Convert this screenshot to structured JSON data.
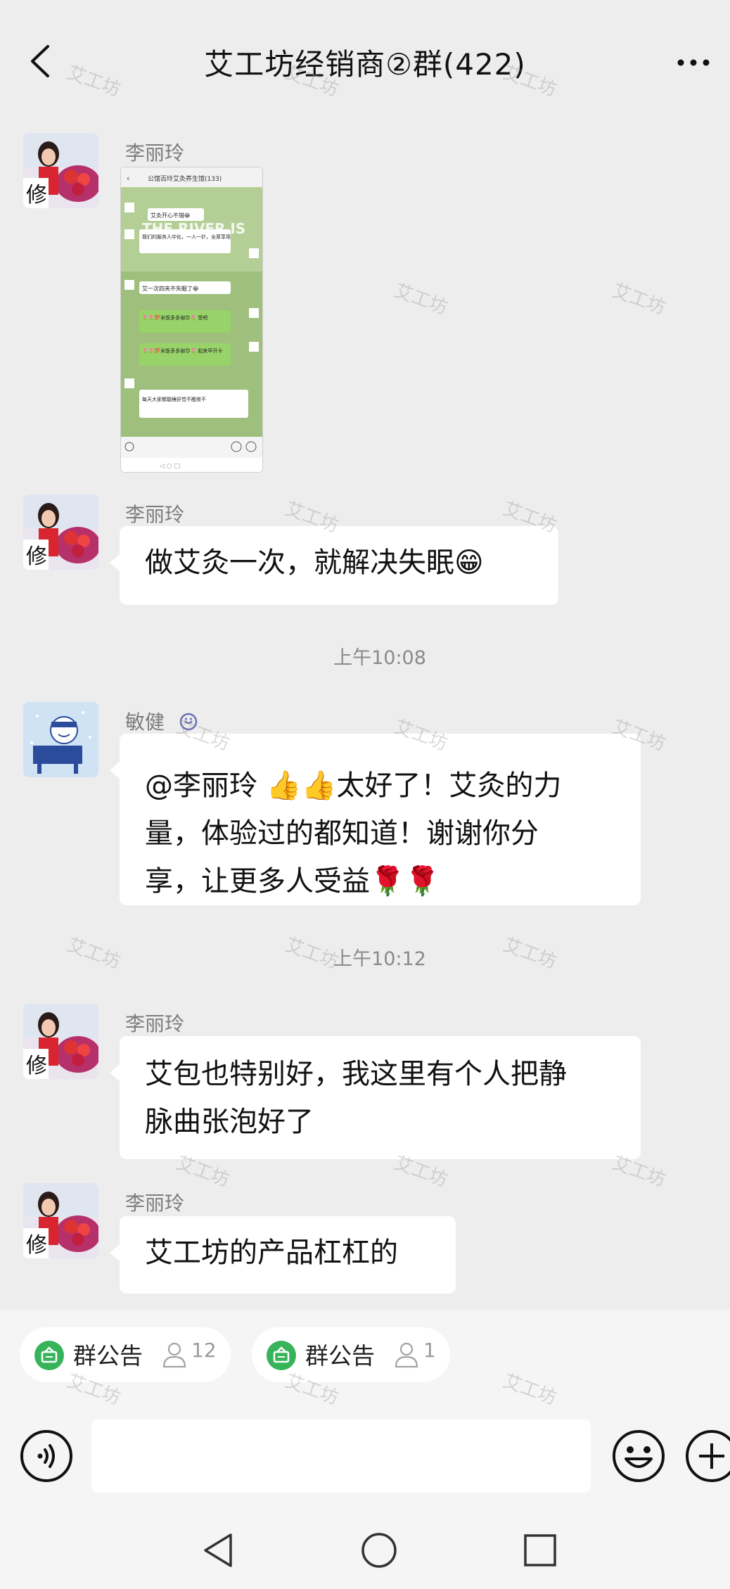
{
  "header": {
    "title": "艾工坊经销商②群(422)"
  },
  "messages": [
    {
      "sender": "李丽玲",
      "type": "image"
    },
    {
      "sender": "李丽玲",
      "text": "做艾灸一次，就解决失眠😁"
    },
    {
      "sender": "敏健",
      "lines": [
        "@李丽玲 👍👍太好了！艾灸的力",
        "量，体验过的都知道！谢谢你分",
        "享，让更多人受益🌹🌹"
      ]
    },
    {
      "sender": "李丽玲",
      "lines": [
        "艾包也特别好，我这里有个人把静",
        "脉曲张泡好了"
      ]
    },
    {
      "sender": "李丽玲",
      "text": "艾工坊的产品杠杠的"
    }
  ],
  "timestamps": [
    "上午10:08",
    "上午10:12"
  ],
  "thumbnail": {
    "title": "公馆百玲艾灸养生馆(133)",
    "banner": "THE RIVER IS",
    "lines": [
      "艾灸开心不错😁",
      "我们的服务人中化，一人一针，全厚享用",
      "艾一次四夹不失眠了😁",
      "🌷🌷💯米饭多多谢😊🌷 受吧",
      "🌷🌷💯米饭多多谢😊🌷 起来早开卡",
      "每天大家都能睡好觉不醒夜不"
    ]
  },
  "announcements": [
    {
      "label": "群公告",
      "count": "12"
    },
    {
      "label": "群公告",
      "count": "1"
    }
  ],
  "watermark": "艾工坊",
  "colors": {
    "background": "#ededed",
    "bubble": "#ffffff",
    "announcement_icon": "#37b45a"
  }
}
